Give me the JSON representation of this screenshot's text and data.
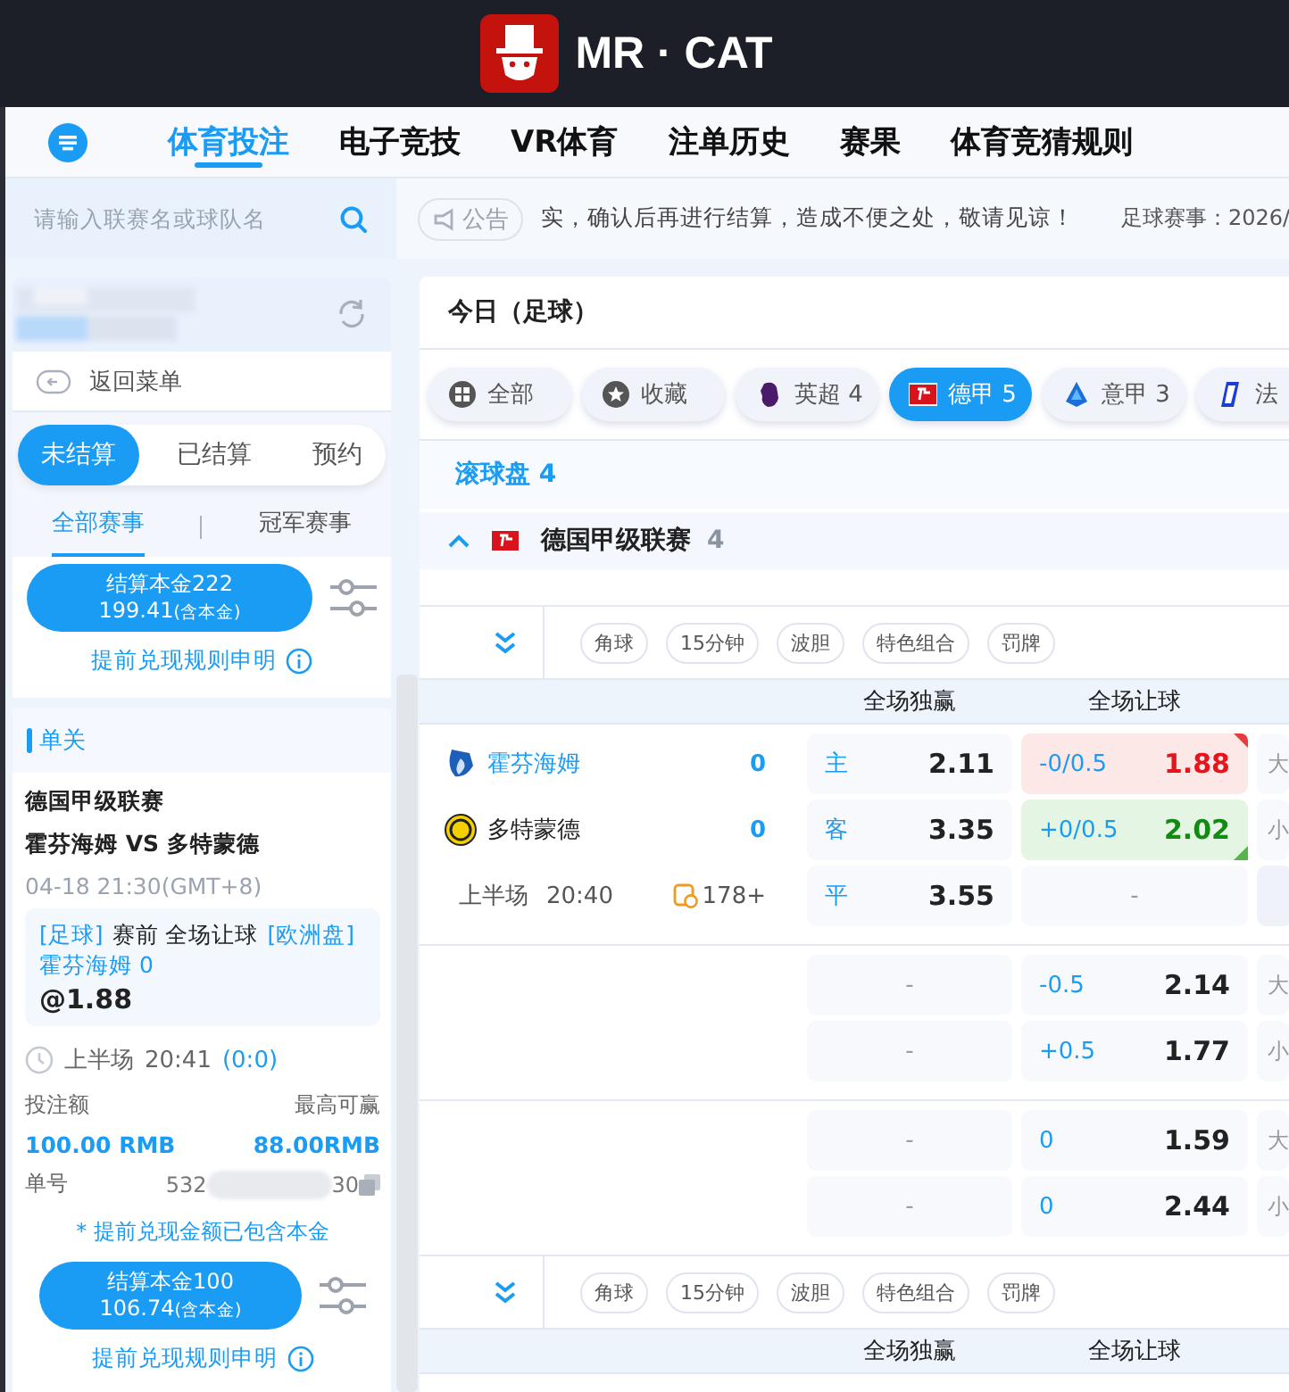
{
  "header": {
    "brand": "MR · CAT"
  },
  "nav": {
    "items": [
      {
        "label": "体育投注",
        "selected": true
      },
      {
        "label": "电子竞技",
        "selected": false
      },
      {
        "label": "VR体育",
        "selected": false
      },
      {
        "label": "注单历史",
        "selected": false
      },
      {
        "label": "赛果",
        "selected": false
      },
      {
        "label": "体育竞猜规则",
        "selected": false
      }
    ]
  },
  "search": {
    "placeholder": "请输入联赛名或球队名"
  },
  "notice": {
    "label": "公告",
    "messages": [
      "实，确认后再进行结算，造成不便之处，敬请见谅！",
      "足球赛事：2026/"
    ]
  },
  "sidebar": {
    "back": "返回菜单",
    "status_tabs": [
      {
        "label": "未结算",
        "selected": true
      },
      {
        "label": "已结算",
        "selected": false
      },
      {
        "label": "预约",
        "selected": false
      }
    ],
    "scope_tabs": [
      {
        "label": "全部赛事",
        "selected": true
      },
      {
        "label": "冠军赛事",
        "selected": false
      }
    ],
    "cashout": {
      "title": "结算本金222",
      "amount": "199.41",
      "amount_note": "(含本金)"
    },
    "rules_link": "提前兑现规则申明",
    "section_title": "单关",
    "bets": [
      {
        "league": "德国甲级联赛",
        "match": "霍芬海姆 VS 多特蒙德",
        "time": "04-18 21:30(GMT+8)",
        "sport": "[足球]",
        "market": "赛前 全场让球",
        "odds_format": "[欧洲盘]",
        "pick": "霍芬海姆 0",
        "odds": "@1.88",
        "period": "上半场",
        "clock": "20:41",
        "score": "(0:0)",
        "stake_label": "投注额",
        "payout_label": "最高可赢",
        "stake": "100.00 RMB",
        "payout": "88.00RMB",
        "ticket_label": "单号",
        "ticket_start": "532",
        "ticket_end": "30",
        "note": "* 提前兑现金额已包含本金",
        "cashout": {
          "title": "结算本金100",
          "amount": "106.74",
          "amount_note": "(含本金)"
        },
        "rules_link": "提前兑现规则申明"
      }
    ]
  },
  "main": {
    "title": "今日（足球）",
    "leagues": [
      {
        "label": "全部",
        "selected": false
      },
      {
        "label": "收藏",
        "selected": false
      },
      {
        "label": "英超",
        "count": "4",
        "selected": false
      },
      {
        "label": "德甲",
        "count": "5",
        "selected": true
      },
      {
        "label": "意甲",
        "count": "3",
        "selected": false
      },
      {
        "label": "法",
        "selected": false
      }
    ],
    "live": {
      "label": "滚球盘",
      "count": "4"
    },
    "league": {
      "name": "德国甲级联赛",
      "count": "4",
      "expanded": true
    },
    "sections": [
      {
        "kind": "filters",
        "items": [
          "角球",
          "15分钟",
          "波胆",
          "特色组合",
          "罚牌"
        ]
      },
      {
        "kind": "header",
        "columns": [
          "全场独赢",
          "全场让球"
        ]
      },
      {
        "kind": "match",
        "teams": [
          {
            "name": "霍芬海姆",
            "score": "0",
            "highlighted": true
          },
          {
            "name": "多特蒙德",
            "score": "0",
            "highlighted": false
          }
        ],
        "period": "上半场",
        "clock": "20:40",
        "markets": "178+",
        "groups": [
          [
            {
              "win": {
                "kind": "odds",
                "label": "主",
                "odds": "2.11"
              },
              "handicap": {
                "kind": "odds",
                "line": "-0/0.5",
                "odds": "1.88",
                "odds_up": true,
                "odds_down": false
              },
              "total": {
                "label": "大"
              }
            },
            {
              "win": {
                "kind": "odds",
                "label": "客",
                "odds": "3.35"
              },
              "handicap": {
                "kind": "odds",
                "line": "+0/0.5",
                "odds": "2.02",
                "odds_up": false,
                "odds_down": true
              },
              "total": {
                "label": "小"
              }
            },
            {
              "win": {
                "kind": "odds",
                "label": "平",
                "odds": "3.55"
              },
              "handicap": {
                "kind": "empty",
                "text": "-"
              }
            }
          ],
          [
            {
              "win": {
                "kind": "empty",
                "text": "-"
              },
              "handicap": {
                "kind": "odds",
                "line": "-0.5",
                "odds": "2.14",
                "odds_up": false,
                "odds_down": false
              },
              "total": {
                "label": "大"
              }
            },
            {
              "win": {
                "kind": "empty",
                "text": "-"
              },
              "handicap": {
                "kind": "odds",
                "line": "+0.5",
                "odds": "1.77",
                "odds_up": false,
                "odds_down": false
              },
              "total": {
                "label": "小"
              }
            }
          ],
          [
            {
              "win": {
                "kind": "empty",
                "text": "-"
              },
              "handicap": {
                "kind": "odds",
                "line": "0",
                "odds": "1.59",
                "odds_up": false,
                "odds_down": false
              },
              "total": {
                "label": "大"
              }
            },
            {
              "win": {
                "kind": "empty",
                "text": "-"
              },
              "handicap": {
                "kind": "odds",
                "line": "0",
                "odds": "2.44",
                "odds_up": false,
                "odds_down": false
              },
              "total": {
                "label": "小"
              }
            }
          ]
        ]
      },
      {
        "kind": "filters",
        "items": [
          "角球",
          "15分钟",
          "波胆",
          "特色组合",
          "罚牌"
        ]
      },
      {
        "kind": "header",
        "columns": [
          "全场独赢",
          "全场让球"
        ]
      }
    ]
  }
}
